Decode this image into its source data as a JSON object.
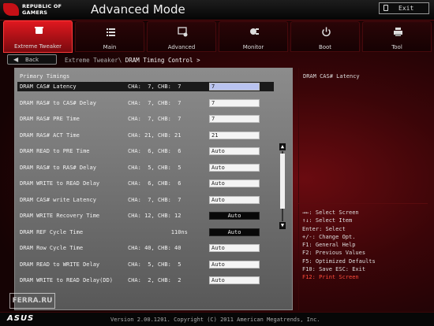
{
  "header": {
    "brand_line1": "REPUBLIC OF",
    "brand_line2": "GAMERS",
    "title": "Advanced Mode",
    "exit_label": "Exit"
  },
  "tabs": [
    {
      "label": "Extreme Tweaker",
      "icon": "chip-icon",
      "active": true
    },
    {
      "label": "Main",
      "icon": "list-icon",
      "active": false
    },
    {
      "label": "Advanced",
      "icon": "advanced-icon",
      "active": false
    },
    {
      "label": "Monitor",
      "icon": "monitor-gauge-icon",
      "active": false
    },
    {
      "label": "Boot",
      "icon": "power-icon",
      "active": false
    },
    {
      "label": "Tool",
      "icon": "printer-tool-icon",
      "active": false
    }
  ],
  "breadcrumb": {
    "back_label": "Back",
    "parent": "Extreme Tweaker\\",
    "current": "DRAM Timing Control >"
  },
  "section_title": "Primary Timings",
  "rows": [
    {
      "label": "DRAM CAS# Latency",
      "channels": "CHA:  7, CHB:  7",
      "value": "7",
      "style": "hl",
      "selected": true
    },
    {
      "label": "DRAM RAS# to CAS# Delay",
      "channels": "CHA:  7, CHB:  7",
      "value": "7",
      "style": "light",
      "selected": false
    },
    {
      "label": "DRAM RAS# PRE Time",
      "channels": "CHA:  7, CHB:  7",
      "value": "7",
      "style": "light",
      "selected": false
    },
    {
      "label": "DRAM RAS# ACT Time",
      "channels": "CHA: 21, CHB: 21",
      "value": "21",
      "style": "light",
      "selected": false
    },
    {
      "label": "DRAM READ to PRE Time",
      "channels": "CHA:  6, CHB:  6",
      "value": "Auto",
      "style": "light",
      "selected": false
    },
    {
      "label": "DRAM RAS# to RAS# Delay",
      "channels": "CHA:  5, CHB:  5",
      "value": "Auto",
      "style": "light",
      "selected": false
    },
    {
      "label": "DRAM WRITE to READ Delay",
      "channels": "CHA:  6, CHB:  6",
      "value": "Auto",
      "style": "light",
      "selected": false
    },
    {
      "label": "DRAM CAS# write Latency",
      "channels": "CHA:  7, CHB:  7",
      "value": "Auto",
      "style": "light",
      "selected": false
    },
    {
      "label": "DRAM WRITE Recovery Time",
      "channels": "CHA: 12, CHB: 12",
      "value": "Auto",
      "style": "dark",
      "selected": false
    },
    {
      "label": "DRAM REF Cycle Time",
      "channels": "             110ns",
      "value": "Auto",
      "style": "dark",
      "selected": false
    },
    {
      "label": "DRAM Row Cycle Time",
      "channels": "CHA: 40, CHB: 40",
      "value": "Auto",
      "style": "light",
      "selected": false
    },
    {
      "label": "DRAM READ to WRITE Delay",
      "channels": "CHA:  5, CHB:  5",
      "value": "Auto",
      "style": "light",
      "selected": false
    },
    {
      "label": "DRAM WRITE to READ Delay(DD)",
      "channels": "CHA:  2, CHB:  2",
      "value": "Auto",
      "style": "light",
      "selected": false
    }
  ],
  "help": {
    "title": "DRAM CAS# Latency"
  },
  "keys": [
    {
      "text": "→←: Select Screen",
      "red": false
    },
    {
      "text": "↑↓: Select Item",
      "red": false
    },
    {
      "text": "Enter: Select",
      "red": false
    },
    {
      "text": "+/-: Change Opt.",
      "red": false
    },
    {
      "text": "F1: General Help",
      "red": false
    },
    {
      "text": "F2: Previous Values",
      "red": false
    },
    {
      "text": "F5: Optimized Defaults",
      "red": false
    },
    {
      "text": "F10: Save  ESC: Exit",
      "red": false
    },
    {
      "text": "F12: Print Screen",
      "red": true
    }
  ],
  "footer": {
    "brand": "ASUS",
    "version": "Version 2.00.1201. Copyright (C) 2011 American Megatrends, Inc."
  },
  "watermark": "FERRA.RU",
  "colors": {
    "accent": "#e0181f",
    "highlight_field": "#b9c3ef",
    "print_screen": "#ff4a3a"
  }
}
